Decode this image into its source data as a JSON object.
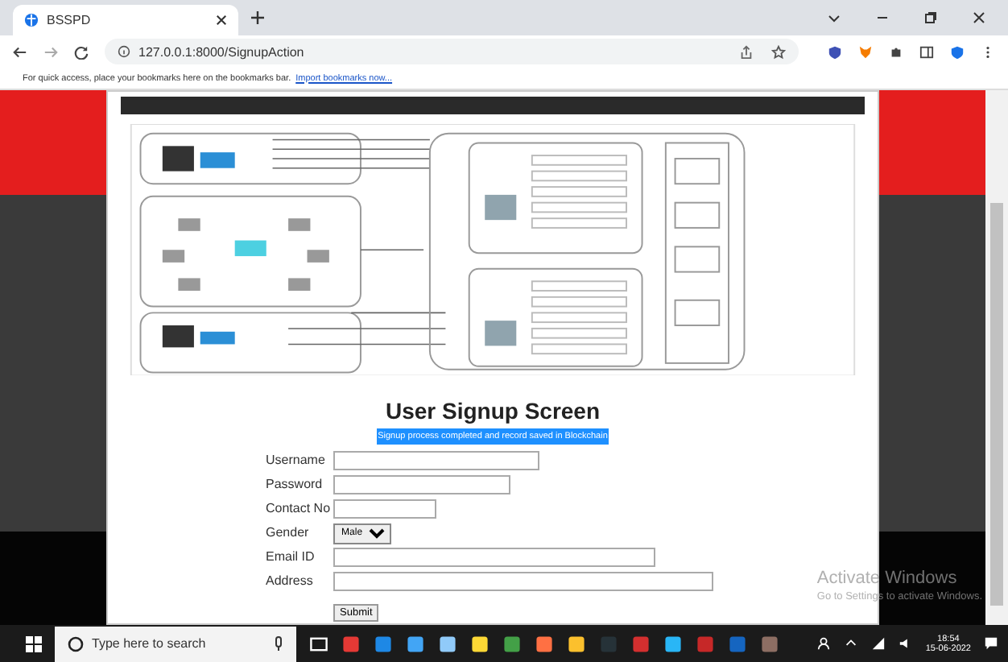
{
  "browser": {
    "tab_title": "BSSPD",
    "url": "127.0.0.1:8000/SignupAction",
    "bookmarks_hint": "For quick access, place your bookmarks here on the bookmarks bar.",
    "bookmarks_link": "Import bookmarks now..."
  },
  "page": {
    "title": "User Signup Screen",
    "message": "Signup process completed and record saved in Blockchain",
    "fields": [
      {
        "label": "Username",
        "kind": "text"
      },
      {
        "label": "Password",
        "kind": "text"
      },
      {
        "label": "Contact No",
        "kind": "text"
      },
      {
        "label": "Gender",
        "kind": "select",
        "value": "Male"
      },
      {
        "label": "Email ID",
        "kind": "text"
      },
      {
        "label": "Address",
        "kind": "text"
      }
    ],
    "submit": "Submit"
  },
  "activation": {
    "title": "Activate Windows",
    "subtitle": "Go to Settings to activate Windows."
  },
  "taskbar": {
    "search_placeholder": "Type here to search",
    "time": "18:54",
    "date": "15-06-2022"
  }
}
